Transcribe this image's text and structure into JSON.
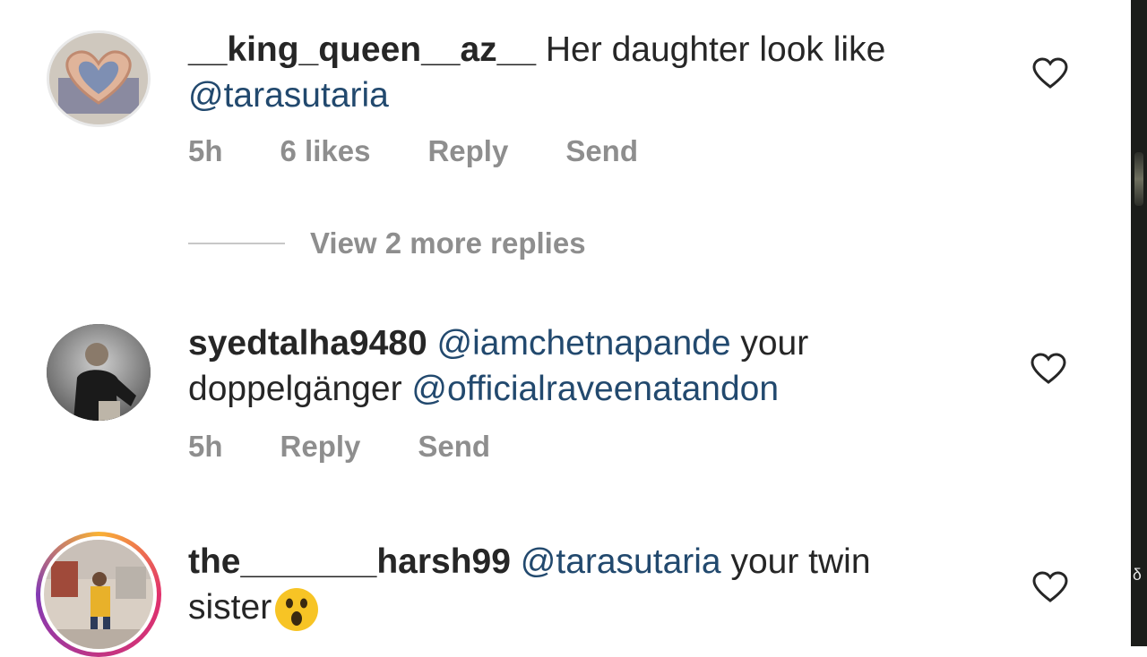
{
  "comments": [
    {
      "username": "__king_queen__az__",
      "text": "Her daughter look like",
      "mentions": [
        "@tarasutaria"
      ],
      "time": "5h",
      "likes": "6 likes",
      "reply_label": "Reply",
      "send_label": "Send",
      "view_replies": "View 2 more replies"
    },
    {
      "username": "syedtalha9480",
      "mention1": "@iamchetnapande",
      "text1": "your",
      "text2": "doppelgänger",
      "mention2": "@officialraveenatandon",
      "time": "5h",
      "reply_label": "Reply",
      "send_label": "Send"
    },
    {
      "username": "the_______harsh99",
      "mention": "@tarasutaria",
      "text1": "your twin",
      "text2": "sister",
      "emoji": "astonished-face-emoji"
    }
  ],
  "icons": {
    "like": "heart-outline-icon"
  },
  "colors": {
    "mention": "#22496e",
    "meta": "#8e8e8e",
    "text": "#262626"
  }
}
